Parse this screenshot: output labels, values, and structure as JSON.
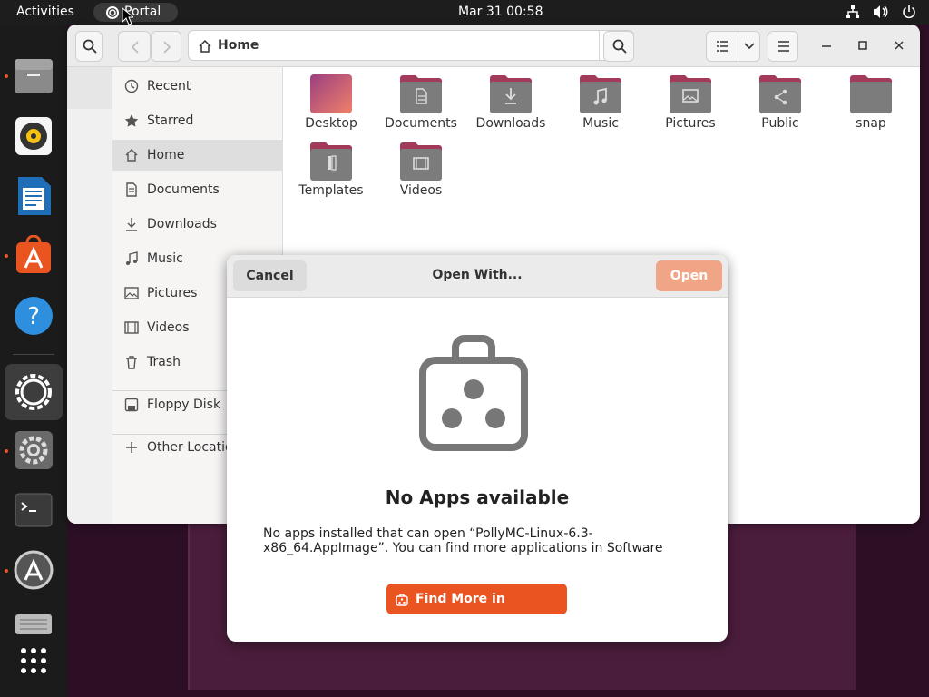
{
  "topbar": {
    "activities": "Activities",
    "app_name": "Portal",
    "clock": "Mar 31  00:58",
    "tray_icons": [
      "network-icon",
      "volume-icon",
      "power-icon"
    ]
  },
  "dock": {
    "items": [
      "files",
      "rhythmbox",
      "libreoffice-writer",
      "ubuntu-software",
      "help",
      "portal",
      "settings",
      "terminal",
      "software-updater",
      "disk-drive",
      "show-apps"
    ]
  },
  "files_window": {
    "path_label": "Home",
    "sidebar": [
      {
        "label": "Recent",
        "icon": "clock-icon"
      },
      {
        "label": "Starred",
        "icon": "star-icon"
      },
      {
        "label": "Home",
        "icon": "home-icon",
        "active": true
      },
      {
        "label": "Documents",
        "icon": "document-icon"
      },
      {
        "label": "Downloads",
        "icon": "download-icon"
      },
      {
        "label": "Music",
        "icon": "music-icon"
      },
      {
        "label": "Pictures",
        "icon": "picture-icon"
      },
      {
        "label": "Videos",
        "icon": "video-icon"
      },
      {
        "label": "Trash",
        "icon": "trash-icon"
      },
      {
        "label": "Floppy Disk",
        "icon": "floppy-icon"
      },
      {
        "label": "Other Locatio",
        "icon": "plus-icon"
      }
    ],
    "folders": [
      {
        "label": "Desktop",
        "emblem": "desktop"
      },
      {
        "label": "Documents",
        "emblem": "document"
      },
      {
        "label": "Downloads",
        "emblem": "download"
      },
      {
        "label": "Music",
        "emblem": "music"
      },
      {
        "label": "Pictures",
        "emblem": "picture"
      },
      {
        "label": "Public",
        "emblem": "share"
      },
      {
        "label": "snap",
        "emblem": "none"
      },
      {
        "label": "Templates",
        "emblem": "template"
      },
      {
        "label": "Videos",
        "emblem": "video"
      }
    ]
  },
  "dialog": {
    "cancel": "Cancel",
    "title": "Open With...",
    "open": "Open",
    "heading": "No Apps available",
    "description": "No apps installed that can open “PollyMC-Linux-6.3-x86_64.AppImage”. You can find more applications in Software",
    "find_button": "Find More in Software"
  },
  "colors": {
    "accent": "#e95420",
    "folder_tab": "#a23a5a",
    "folder_body": "#7c7c7c"
  }
}
